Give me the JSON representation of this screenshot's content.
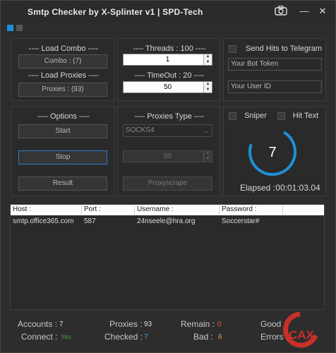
{
  "window": {
    "title": "Smtp Checker by X-Splinter v1 | SPD-Tech",
    "minimize": "—",
    "close": "✕"
  },
  "combo": {
    "load_label": "---- Load Combo ----",
    "button": "Combo : (7)",
    "proxies_label": "---- Load Proxies ----",
    "proxies_button": "Proxies : (93)"
  },
  "threads": {
    "label": "---- Threads : 100 ----",
    "value": "1",
    "timeout_label": "---- TimeOut : 20 ----",
    "timeout_value": "50"
  },
  "telegram": {
    "label": "Send Hits to Telegram",
    "token_placeholder": "Your Bot Token",
    "userid_placeholder": "Your User ID"
  },
  "options": {
    "label": "---- Options ----",
    "start": "Start",
    "stop": "Stop",
    "result": "Result"
  },
  "proxies_type": {
    "label": "---- Proxies Type ----",
    "selected": "SOCKS4",
    "value": "50",
    "scrape": "Proxyscrape"
  },
  "sniper": {
    "sniper_label": "Sniper",
    "hit_text_label": "Hit Text",
    "gauge_value": "7",
    "elapsed_label": "Elapsed :",
    "elapsed_value": "00:01:03.04",
    "gauge_fraction": 0.72
  },
  "grid": {
    "columns": [
      "Host :",
      "Port :",
      "Username :",
      "Password :"
    ],
    "rows": [
      [
        "smtp.office365.com",
        "587",
        "24nseele@hra.org",
        "Soccerstar#"
      ]
    ]
  },
  "stats": {
    "accounts_label": "Accounts :",
    "accounts": "7",
    "proxies_label": "Proxies :",
    "proxies": "93",
    "remain_label": "Remain :",
    "remain": "0",
    "good_label": "Good :",
    "connect_label": "Connect :",
    "connect": "Yes",
    "checked_label": "Checked :",
    "checked": "7",
    "bad_label": "Bad :",
    "bad": "6",
    "errors_label": "Errors :"
  },
  "colors": {
    "accent": "#1e8fd6",
    "remain": "#e04b3a",
    "connect": "#2fa33a",
    "checked": "#4aa8e8",
    "bad": "#e0a060",
    "watermark": "#c8302a"
  }
}
